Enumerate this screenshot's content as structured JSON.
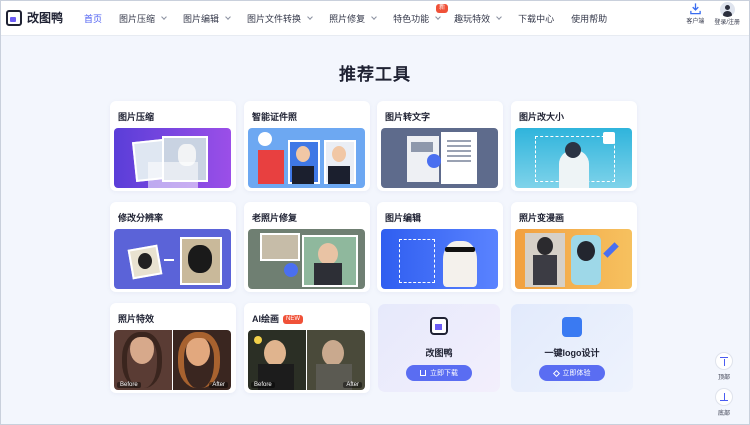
{
  "brand": {
    "name": "改图鸭"
  },
  "nav": {
    "items": [
      {
        "label": "首页",
        "active": true,
        "dropdown": false
      },
      {
        "label": "图片压缩",
        "dropdown": true
      },
      {
        "label": "图片编辑",
        "dropdown": true
      },
      {
        "label": "图片文件转换",
        "dropdown": true
      },
      {
        "label": "照片修复",
        "dropdown": true
      },
      {
        "label": "特色功能",
        "dropdown": true,
        "badge": "新"
      },
      {
        "label": "趣玩特效",
        "dropdown": true
      },
      {
        "label": "下载中心",
        "dropdown": false
      },
      {
        "label": "使用帮助",
        "dropdown": false
      }
    ]
  },
  "header_right": {
    "client_label": "客户端",
    "login_label": "登录/注册"
  },
  "section_title": "推荐工具",
  "cards": [
    {
      "title": "图片压缩"
    },
    {
      "title": "智能证件照"
    },
    {
      "title": "图片转文字"
    },
    {
      "title": "图片改大小"
    },
    {
      "title": "修改分辨率"
    },
    {
      "title": "老照片修复"
    },
    {
      "title": "图片编辑"
    },
    {
      "title": "照片变漫画"
    },
    {
      "title": "照片特效",
      "before": "Before",
      "after": "After"
    },
    {
      "title": "AI绘画",
      "badge": "NEW",
      "before": "Before",
      "after": "After"
    }
  ],
  "promos": [
    {
      "title": "改图鸭",
      "button": "立即下载"
    },
    {
      "title": "一键logo设计",
      "button": "立即体验"
    }
  ],
  "float": {
    "top_label": "顶部",
    "bottom_label": "底部"
  },
  "colors": {
    "accent": "#4a5cf2",
    "badge": "#f05138",
    "page_bg": "#f3f6fd"
  }
}
